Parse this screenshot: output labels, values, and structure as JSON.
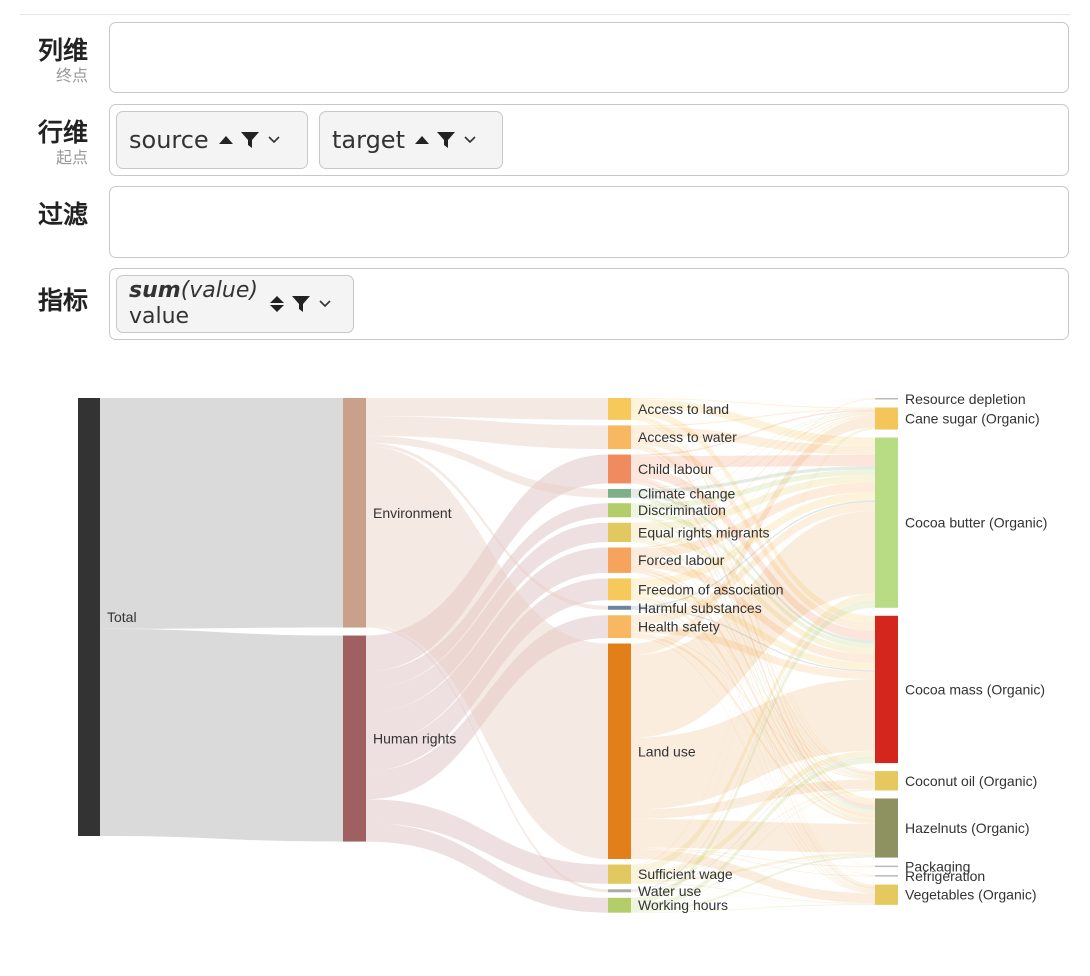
{
  "panel": {
    "columns": {
      "label": "列维",
      "sublabel": "终点",
      "chips": []
    },
    "rows": {
      "label": "行维",
      "sublabel": "起点",
      "chips": [
        {
          "name": "source"
        },
        {
          "name": "target"
        }
      ]
    },
    "filter": {
      "label": "过滤",
      "chips": []
    },
    "metrics": {
      "label": "指标",
      "chip": {
        "agg": "sum",
        "field_expr": "(value)",
        "field": "value"
      }
    }
  },
  "chart_data": {
    "type": "sankey",
    "levels": [
      [
        {
          "name": "Total",
          "color": "#333333",
          "value": 100
        }
      ],
      [
        {
          "name": "Environment",
          "color": "#c9a18a",
          "value": 51.7
        },
        {
          "name": "Human rights",
          "color": "#a05f61",
          "value": 46.4
        }
      ],
      [
        {
          "name": "Access to land",
          "color": "#f7c85a",
          "value": 5.0
        },
        {
          "name": "Access to water",
          "color": "#f8b862",
          "value": 5.4
        },
        {
          "name": "Child labour",
          "color": "#f08b60",
          "value": 6.6
        },
        {
          "name": "Climate change",
          "color": "#7faf86",
          "value": 2.0
        },
        {
          "name": "Discrimination",
          "color": "#b2cd6a",
          "value": 3.2
        },
        {
          "name": "Equal rights migrants",
          "color": "#e2c95f",
          "value": 4.4
        },
        {
          "name": "Forced labour",
          "color": "#f6a45d",
          "value": 5.8
        },
        {
          "name": "Freedom of association",
          "color": "#f7c85a",
          "value": 5.0
        },
        {
          "name": "Harmful substances",
          "color": "#68879b",
          "value": 0.9
        },
        {
          "name": "Health safety",
          "color": "#f8b862",
          "value": 5.2
        },
        {
          "name": "Land use",
          "color": "#e27f18",
          "value": 49.2
        },
        {
          "name": "Sufficient wage",
          "color": "#e2c95f",
          "value": 4.4
        },
        {
          "name": "Water use",
          "color": "#aaaaaa",
          "value": 0.3
        },
        {
          "name": "Working hours",
          "color": "#b2cd6a",
          "value": 3.4
        }
      ],
      [
        {
          "name": "Resource depletion",
          "color": "#bbbbbb",
          "value": 0.2
        },
        {
          "name": "Cane sugar (Organic)",
          "color": "#f3c55b",
          "value": 5.0
        },
        {
          "name": "Cocoa butter (Organic)",
          "color": "#b7dc84",
          "value": 38.6
        },
        {
          "name": "Cocoa mass (Organic)",
          "color": "#d5261e",
          "value": 33.4
        },
        {
          "name": "Coconut oil (Organic)",
          "color": "#e5c95f",
          "value": 4.4
        },
        {
          "name": "Hazelnuts (Organic)",
          "color": "#8e9160",
          "value": 13.4
        },
        {
          "name": "Packaging",
          "color": "#bbbbbb",
          "value": 0.2
        },
        {
          "name": "Refrigeration",
          "color": "#bbbbbb",
          "value": 0.2
        },
        {
          "name": "Vegetables (Organic)",
          "color": "#e5c95f",
          "value": 4.6
        }
      ]
    ]
  }
}
